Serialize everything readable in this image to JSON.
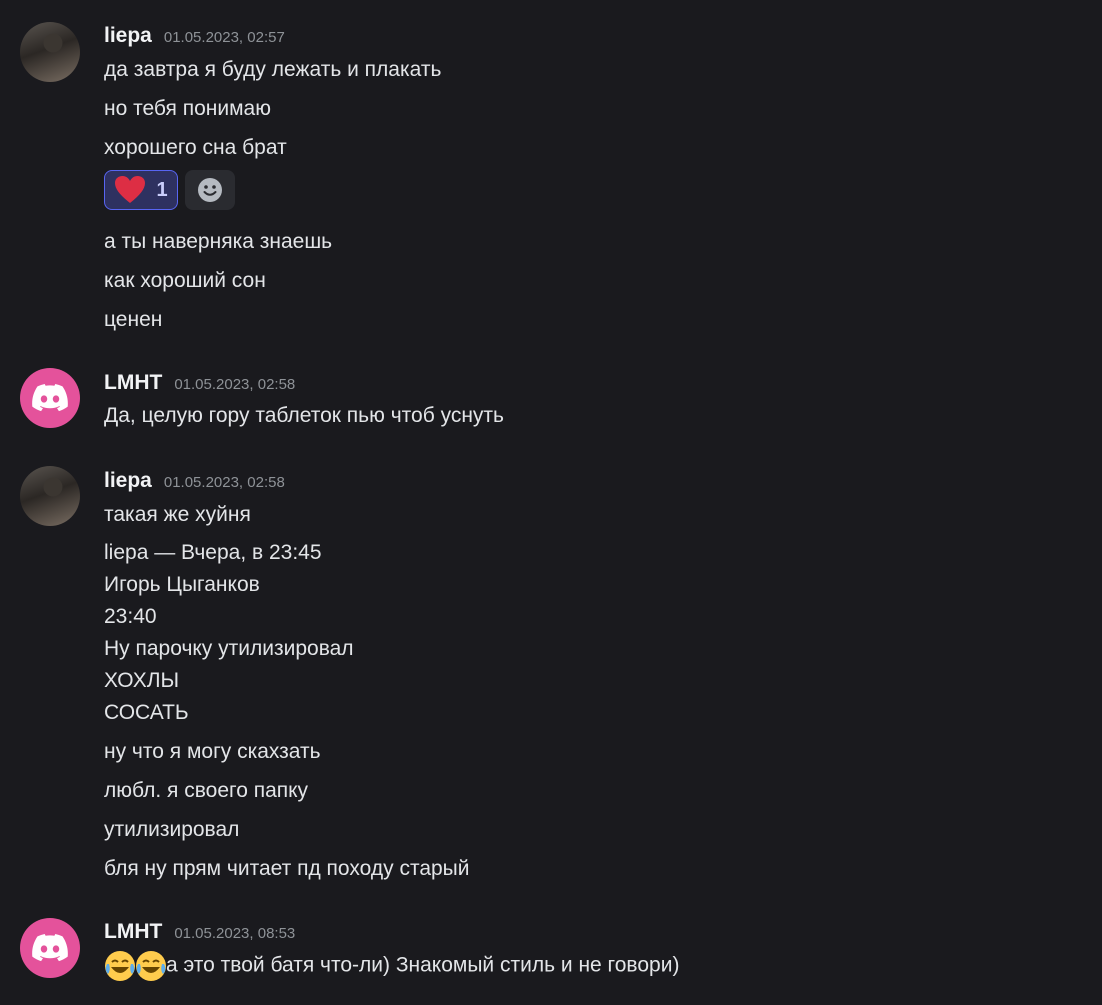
{
  "messages": [
    {
      "author": "liepa",
      "time": "01.05.2023, 02:57",
      "avatar": "photo-avatar",
      "lines": [
        "да завтра я буду лежать и плакать",
        "но тебя понимаю",
        "хорошего сна брат"
      ],
      "reaction": {
        "emoji": "heart-icon",
        "count": "1"
      },
      "lines_after": [
        "а ты наверняка знаешь",
        "как хороший сон",
        "ценен"
      ]
    },
    {
      "author": "LMHT",
      "time": "01.05.2023, 02:58",
      "avatar": "discord-logo-avatar",
      "lines": [
        "Да, целую гору таблеток пью чтоб уснуть"
      ]
    },
    {
      "author": "liepa",
      "time": "01.05.2023, 02:58",
      "avatar": "photo-avatar",
      "lines": [
        "такая же хуйня"
      ],
      "quote": [
        "liepa — Вчера, в 23:45",
        "Игорь Цыганков",
        "23:40",
        "Ну парочку утилизировал",
        "ХОХЛЫ",
        "СОСАТЬ"
      ],
      "lines_after": [
        "ну что я могу скахзать",
        "любл. я своего папку",
        "утилизировал",
        "бля ну прям читает пд походу старый"
      ]
    },
    {
      "author": "LMHT",
      "time": "01.05.2023, 08:53",
      "avatar": "discord-logo-avatar",
      "lines": [
        "а это твой батя что-ли) Знакомый стиль и не говори)"
      ],
      "emojis": [
        "joy-emoji",
        "joy-emoji"
      ]
    }
  ],
  "colors": {
    "background": "#1a1a1e",
    "discord_avatar": "#e4529b",
    "reaction_border": "#5865f2"
  }
}
